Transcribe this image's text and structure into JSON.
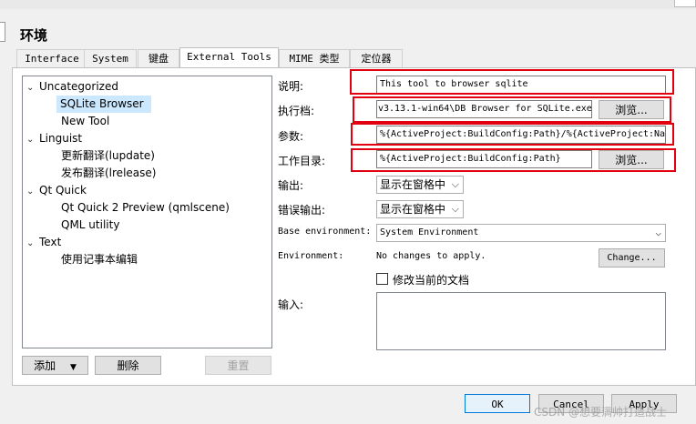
{
  "window": {
    "title": "环境"
  },
  "tabs": [
    "Interface",
    "System",
    "键盘",
    "External Tools",
    "MIME 类型",
    "定位器"
  ],
  "tree": {
    "groups": [
      {
        "label": "Uncategorized",
        "items": [
          "SQLite Browser",
          "New Tool"
        ]
      },
      {
        "label": "Linguist",
        "items": [
          "更新翻译(lupdate)",
          "发布翻译(lrelease)"
        ]
      },
      {
        "label": "Qt Quick",
        "items": [
          "Qt Quick 2 Preview (qmlscene)",
          "QML utility"
        ]
      },
      {
        "label": "Text",
        "items": [
          "使用记事本编辑"
        ]
      }
    ],
    "selected": "SQLite Browser"
  },
  "left_buttons": {
    "add": "添加",
    "delete": "删除",
    "reset": "重置"
  },
  "form": {
    "description_label": "说明:",
    "description_value": "This tool to browser sqlite",
    "executable_label": "执行档:",
    "executable_value": "v3.13.1-win64\\DB Browser for SQLite.exe",
    "browse_label": "浏览...",
    "arguments_label": "参数:",
    "arguments_value": "%{ActiveProject:BuildConfig:Path}/%{ActiveProject:Nam",
    "workdir_label": "工作目录:",
    "workdir_value": "%{ActiveProject:BuildConfig:Path}",
    "output_label": "输出:",
    "output_value": "显示在窗格中",
    "error_output_label": "错误输出:",
    "error_output_value": "显示在窗格中",
    "base_env_label": "Base environment:",
    "base_env_value": "System Environment",
    "environment_label": "Environment:",
    "environment_value": "No changes to apply.",
    "change_label": "Change...",
    "modify_doc_label": "修改当前的文档",
    "input_label": "输入:"
  },
  "dialog_buttons": {
    "ok": "OK",
    "cancel": "Cancel",
    "apply": "Apply"
  },
  "watermark": "CSDN @想要满帅打造战士",
  "colors": {
    "highlight": "#e0000f",
    "selection": "#cce8ff",
    "accent_border": "#0078d7"
  }
}
